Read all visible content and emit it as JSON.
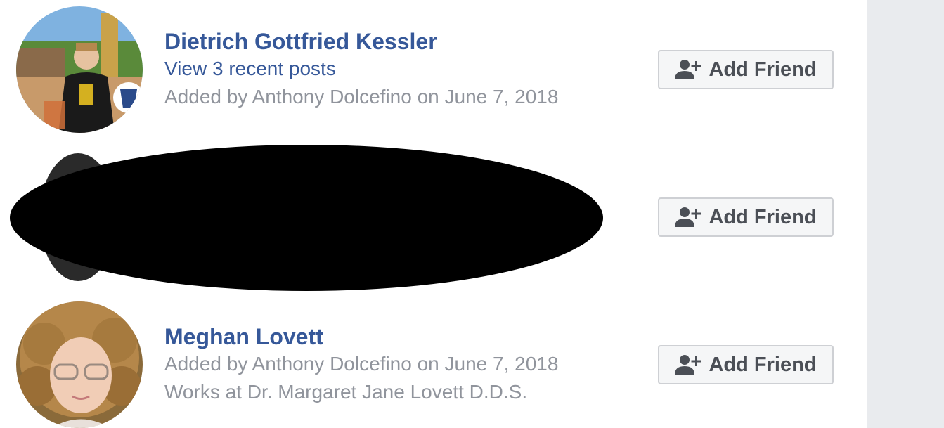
{
  "members": [
    {
      "name": "Dietrich Gottfried Kessler",
      "recent_posts_link": "View 3 recent posts",
      "added_by": "Added by Anthony Dolcefino on June 7, 2018",
      "button_label": "Add Friend",
      "button_icon": "add-friend-icon"
    },
    {
      "button_label": "Add Friend",
      "button_icon": "add-friend-icon"
    },
    {
      "name": "Meghan Lovett",
      "added_by": "Added by Anthony Dolcefino on June 7, 2018",
      "work": "Works at Dr. Margaret Jane Lovett D.D.S.",
      "button_label": "Add Friend",
      "button_icon": "add-friend-icon"
    }
  ],
  "colors": {
    "name_link": "#365899",
    "meta_text": "#90949c",
    "button_bg": "#f5f6f7",
    "button_border": "#ced0d4",
    "button_text": "#4b4f56",
    "right_rail": "#e9ebee",
    "redaction": "#000000"
  }
}
